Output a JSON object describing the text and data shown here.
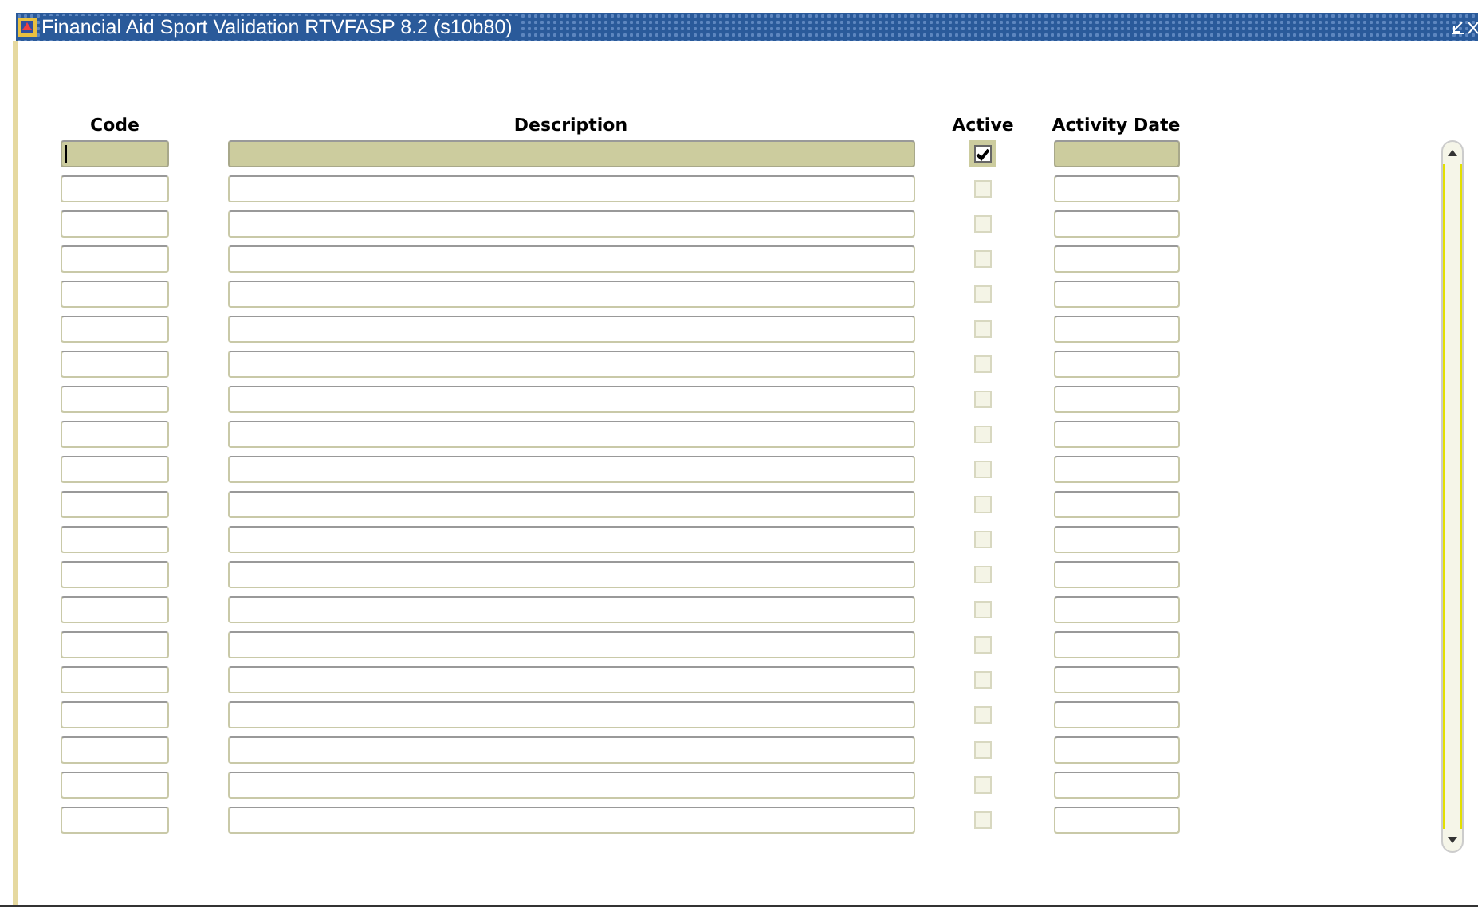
{
  "window": {
    "title": "Financial Aid Sport Validation  RTVFASP  8.2  (s10b80)"
  },
  "columns": [
    "Code",
    "Description",
    "Active",
    "Activity Date"
  ],
  "rows": [
    {
      "selected": true,
      "checked": true
    },
    {
      "selected": false,
      "checked": false
    },
    {
      "selected": false,
      "checked": false
    },
    {
      "selected": false,
      "checked": false
    },
    {
      "selected": false,
      "checked": false
    },
    {
      "selected": false,
      "checked": false
    },
    {
      "selected": false,
      "checked": false
    },
    {
      "selected": false,
      "checked": false
    },
    {
      "selected": false,
      "checked": false
    },
    {
      "selected": false,
      "checked": false
    },
    {
      "selected": false,
      "checked": false
    },
    {
      "selected": false,
      "checked": false
    },
    {
      "selected": false,
      "checked": false
    },
    {
      "selected": false,
      "checked": false
    },
    {
      "selected": false,
      "checked": false
    },
    {
      "selected": false,
      "checked": false
    },
    {
      "selected": false,
      "checked": false
    },
    {
      "selected": false,
      "checked": false
    },
    {
      "selected": false,
      "checked": false
    },
    {
      "selected": false,
      "checked": false
    }
  ]
}
